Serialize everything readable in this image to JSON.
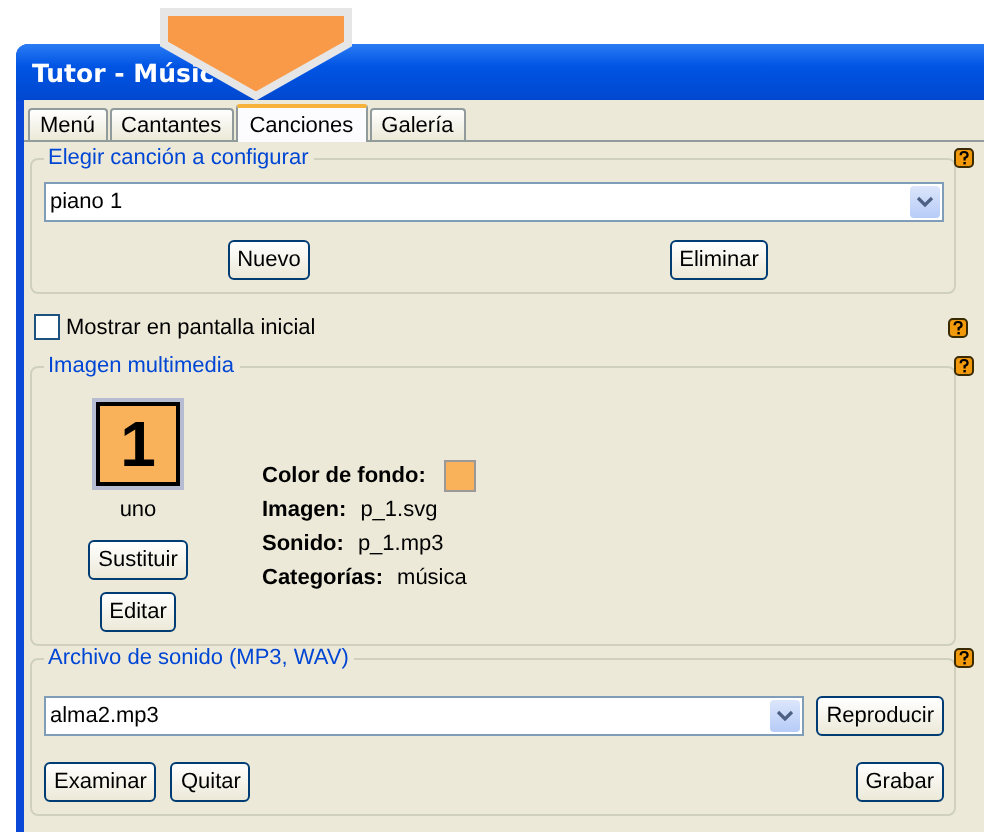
{
  "window": {
    "title": "Tutor - Músic"
  },
  "tabs": [
    {
      "label": "Menú",
      "selected": false
    },
    {
      "label": "Cantantes",
      "selected": false
    },
    {
      "label": "Canciones",
      "selected": true
    },
    {
      "label": "Galería",
      "selected": false
    }
  ],
  "song_group": {
    "title": "Elegir canción a configurar",
    "value": "piano 1",
    "buttons": [
      "Nuevo",
      "Eliminar"
    ]
  },
  "show_on_start": {
    "label": "Mostrar en pantalla inicial",
    "checked": false
  },
  "media_group": {
    "title": "Imagen multimedia",
    "tile": {
      "text": "1",
      "caption": "uno",
      "color": "#f9b15a"
    },
    "buttons": [
      "Sustituir",
      "Editar"
    ],
    "color_label": "Color de fondo:",
    "properties": [
      {
        "label": "Imagen:",
        "value": "p_1.svg"
      },
      {
        "label": "Sonido:",
        "value": "p_1.mp3"
      },
      {
        "label": "Categorías:",
        "value": "música"
      }
    ]
  },
  "sound_group": {
    "title": "Archivo de sonido (MP3, WAV)",
    "value": "alma2.mp3",
    "play_button": "Reproducir",
    "buttons": [
      "Examinar",
      "Quitar"
    ],
    "record_button": "Grabar"
  }
}
